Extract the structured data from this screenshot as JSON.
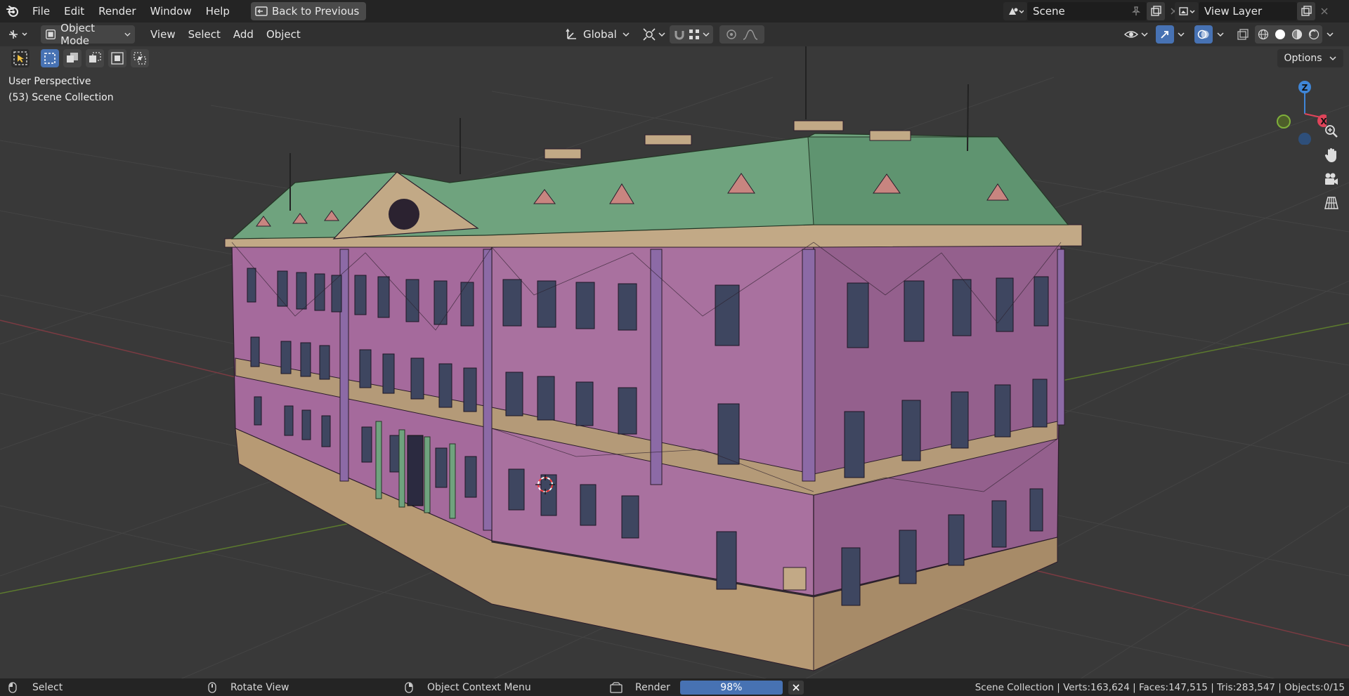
{
  "menu": {
    "items": [
      "File",
      "Edit",
      "Render",
      "Window",
      "Help"
    ],
    "back_button": "Back to Previous"
  },
  "scene": {
    "name": "Scene"
  },
  "view_layer": {
    "name": "View Layer"
  },
  "header": {
    "mode": "Object Mode",
    "menus": [
      "View",
      "Select",
      "Add",
      "Object"
    ],
    "transform_orientation": "Global"
  },
  "viewport": {
    "perspective": "User Perspective",
    "collection": "(53) Scene Collection",
    "options_label": "Options",
    "gizmo_axes": {
      "z": "Z",
      "x": "X"
    }
  },
  "status": {
    "select": "Select",
    "rotate": "Rotate View",
    "context": "Object Context Menu",
    "render_label": "Render",
    "render_progress": "98%",
    "stats": "Scene Collection | Verts:163,624 | Faces:147,515 | Tris:283,547 | Objects:0/15"
  },
  "colors": {
    "accent": "#4772b3",
    "wall": "#a56a9c",
    "roof": "#6fa37e",
    "cornice": "#c2a986",
    "axis_x": "#e0445a",
    "axis_y": "#7fb03a",
    "axis_z": "#3f86d8"
  }
}
